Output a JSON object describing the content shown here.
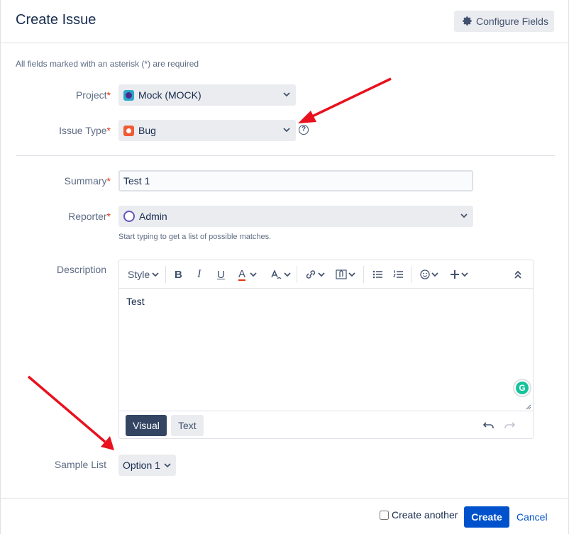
{
  "header": {
    "title": "Create Issue",
    "configure_label": "Configure Fields"
  },
  "required_note": "All fields marked with an asterisk (*) are required",
  "fields": {
    "project": {
      "label": "Project",
      "value": "Mock (MOCK)"
    },
    "issue_type": {
      "label": "Issue Type",
      "value": "Bug"
    },
    "summary": {
      "label": "Summary",
      "value": "Test 1"
    },
    "reporter": {
      "label": "Reporter",
      "value": "Admin",
      "hint": "Start typing to get a list of possible matches."
    },
    "description": {
      "label": "Description",
      "toolbar": {
        "style_label": "Style"
      },
      "content": "Test",
      "modes": {
        "visual": "Visual",
        "text": "Text"
      }
    },
    "sample_list": {
      "label": "Sample List",
      "value": "Option 1"
    }
  },
  "required_marker": "*",
  "help_glyph": "?",
  "grammarly_glyph": "G",
  "footer": {
    "create_another": "Create another",
    "create_label": "Create",
    "cancel_label": "Cancel"
  },
  "colors": {
    "primary": "#0052cc",
    "annotation_arrow": "#e8111d",
    "required": "#de350b"
  }
}
